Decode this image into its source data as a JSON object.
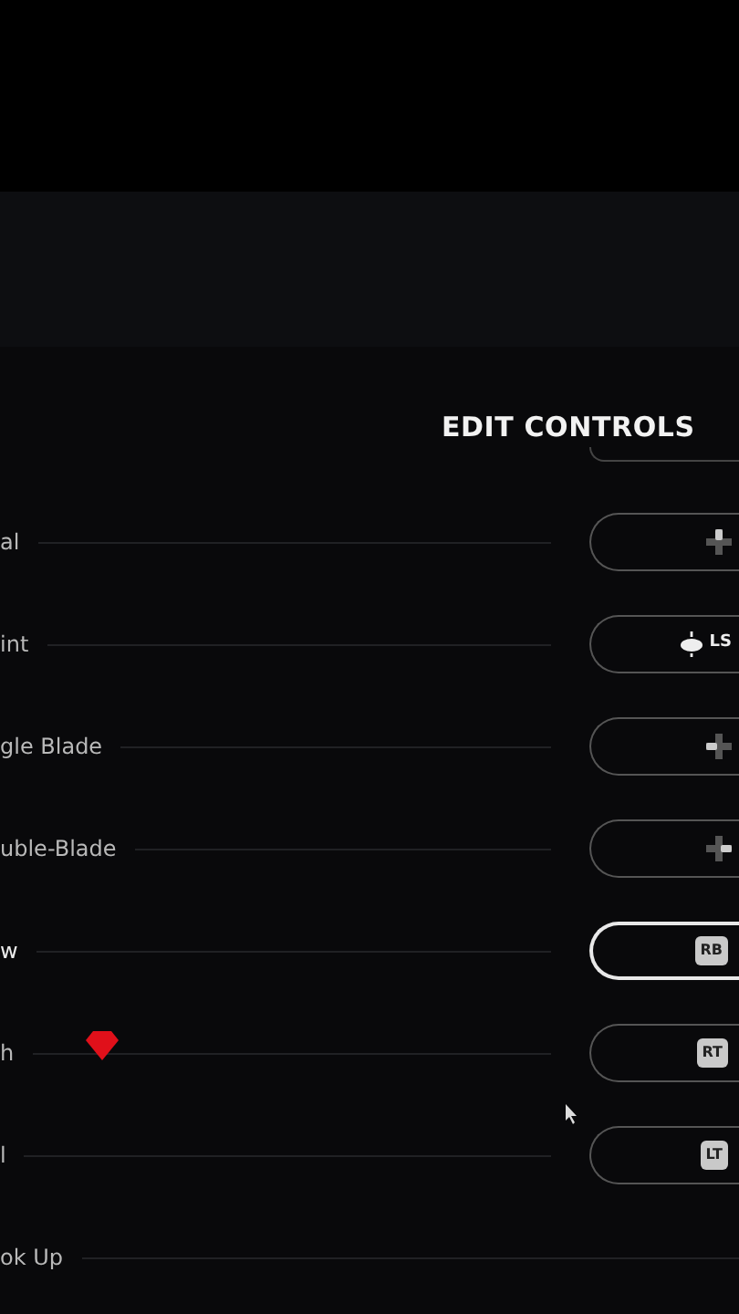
{
  "title": "EDIT CONTROLS",
  "rows": [
    {
      "label": "al",
      "binding": {
        "kind": "dpad_up"
      },
      "selected": false,
      "marked": false
    },
    {
      "label": "int",
      "binding": {
        "kind": "stick",
        "text": "LS"
      },
      "selected": false,
      "marked": false
    },
    {
      "label": "gle Blade",
      "binding": {
        "kind": "dpad_left"
      },
      "selected": false,
      "marked": false
    },
    {
      "label": "uble-Blade",
      "binding": {
        "kind": "dpad_right"
      },
      "selected": false,
      "marked": false
    },
    {
      "label": "w",
      "binding": {
        "kind": "badge",
        "text": "RB"
      },
      "selected": true,
      "marked": false
    },
    {
      "label": "h",
      "binding": {
        "kind": "badge",
        "text": "RT"
      },
      "selected": false,
      "marked": true
    },
    {
      "label": "l",
      "binding": {
        "kind": "badge",
        "text": "LT"
      },
      "selected": false,
      "marked": false
    },
    {
      "label": "ok Up",
      "selected": false,
      "marked": false
    }
  ]
}
